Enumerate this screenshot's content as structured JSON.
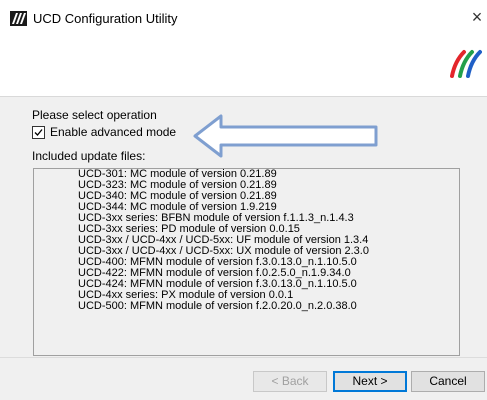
{
  "window": {
    "title": "UCD Configuration Utility",
    "close_glyph": "×",
    "icon": "app-icon",
    "logo": "brand-logo"
  },
  "main": {
    "prompt": "Please select operation",
    "advanced_checkbox": {
      "label": "Enable advanced mode",
      "checked": true
    },
    "included_label": "Included update files:",
    "files": [
      "UCD-301: MC module of version 0.21.89",
      "UCD-323: MC module of version 0.21.89",
      "UCD-340: MC module of version 0.21.89",
      "UCD-344: MC module of version 1.9.219",
      "UCD-3xx series: BFBN module of version f.1.1.3_n.1.4.3",
      "UCD-3xx series: PD module of version 0.0.15",
      "UCD-3xx / UCD-4xx / UCD-5xx: UF module of version 1.3.4",
      "UCD-3xx / UCD-4xx / UCD-5xx: UX module of version 2.3.0",
      "UCD-400: MFMN module of version f.3.0.13.0_n.1.10.5.0",
      "UCD-422: MFMN module of version f.0.2.5.0_n.1.9.34.0",
      "UCD-424: MFMN module of version f.3.0.13.0_n.1.10.5.0",
      "UCD-4xx series: PX module of version 0.0.1",
      "UCD-500: MFMN module of version f.2.0.20.0_n.2.0.38.0"
    ]
  },
  "footer": {
    "back_label": "< Back",
    "next_label": "Next >",
    "cancel_label": "Cancel"
  },
  "colors": {
    "logo_red": "#e3262b",
    "logo_green": "#22a04b",
    "logo_blue": "#1f5fc6",
    "arrow_outline": "#7f9fd0",
    "default_button": "#0078d7"
  }
}
